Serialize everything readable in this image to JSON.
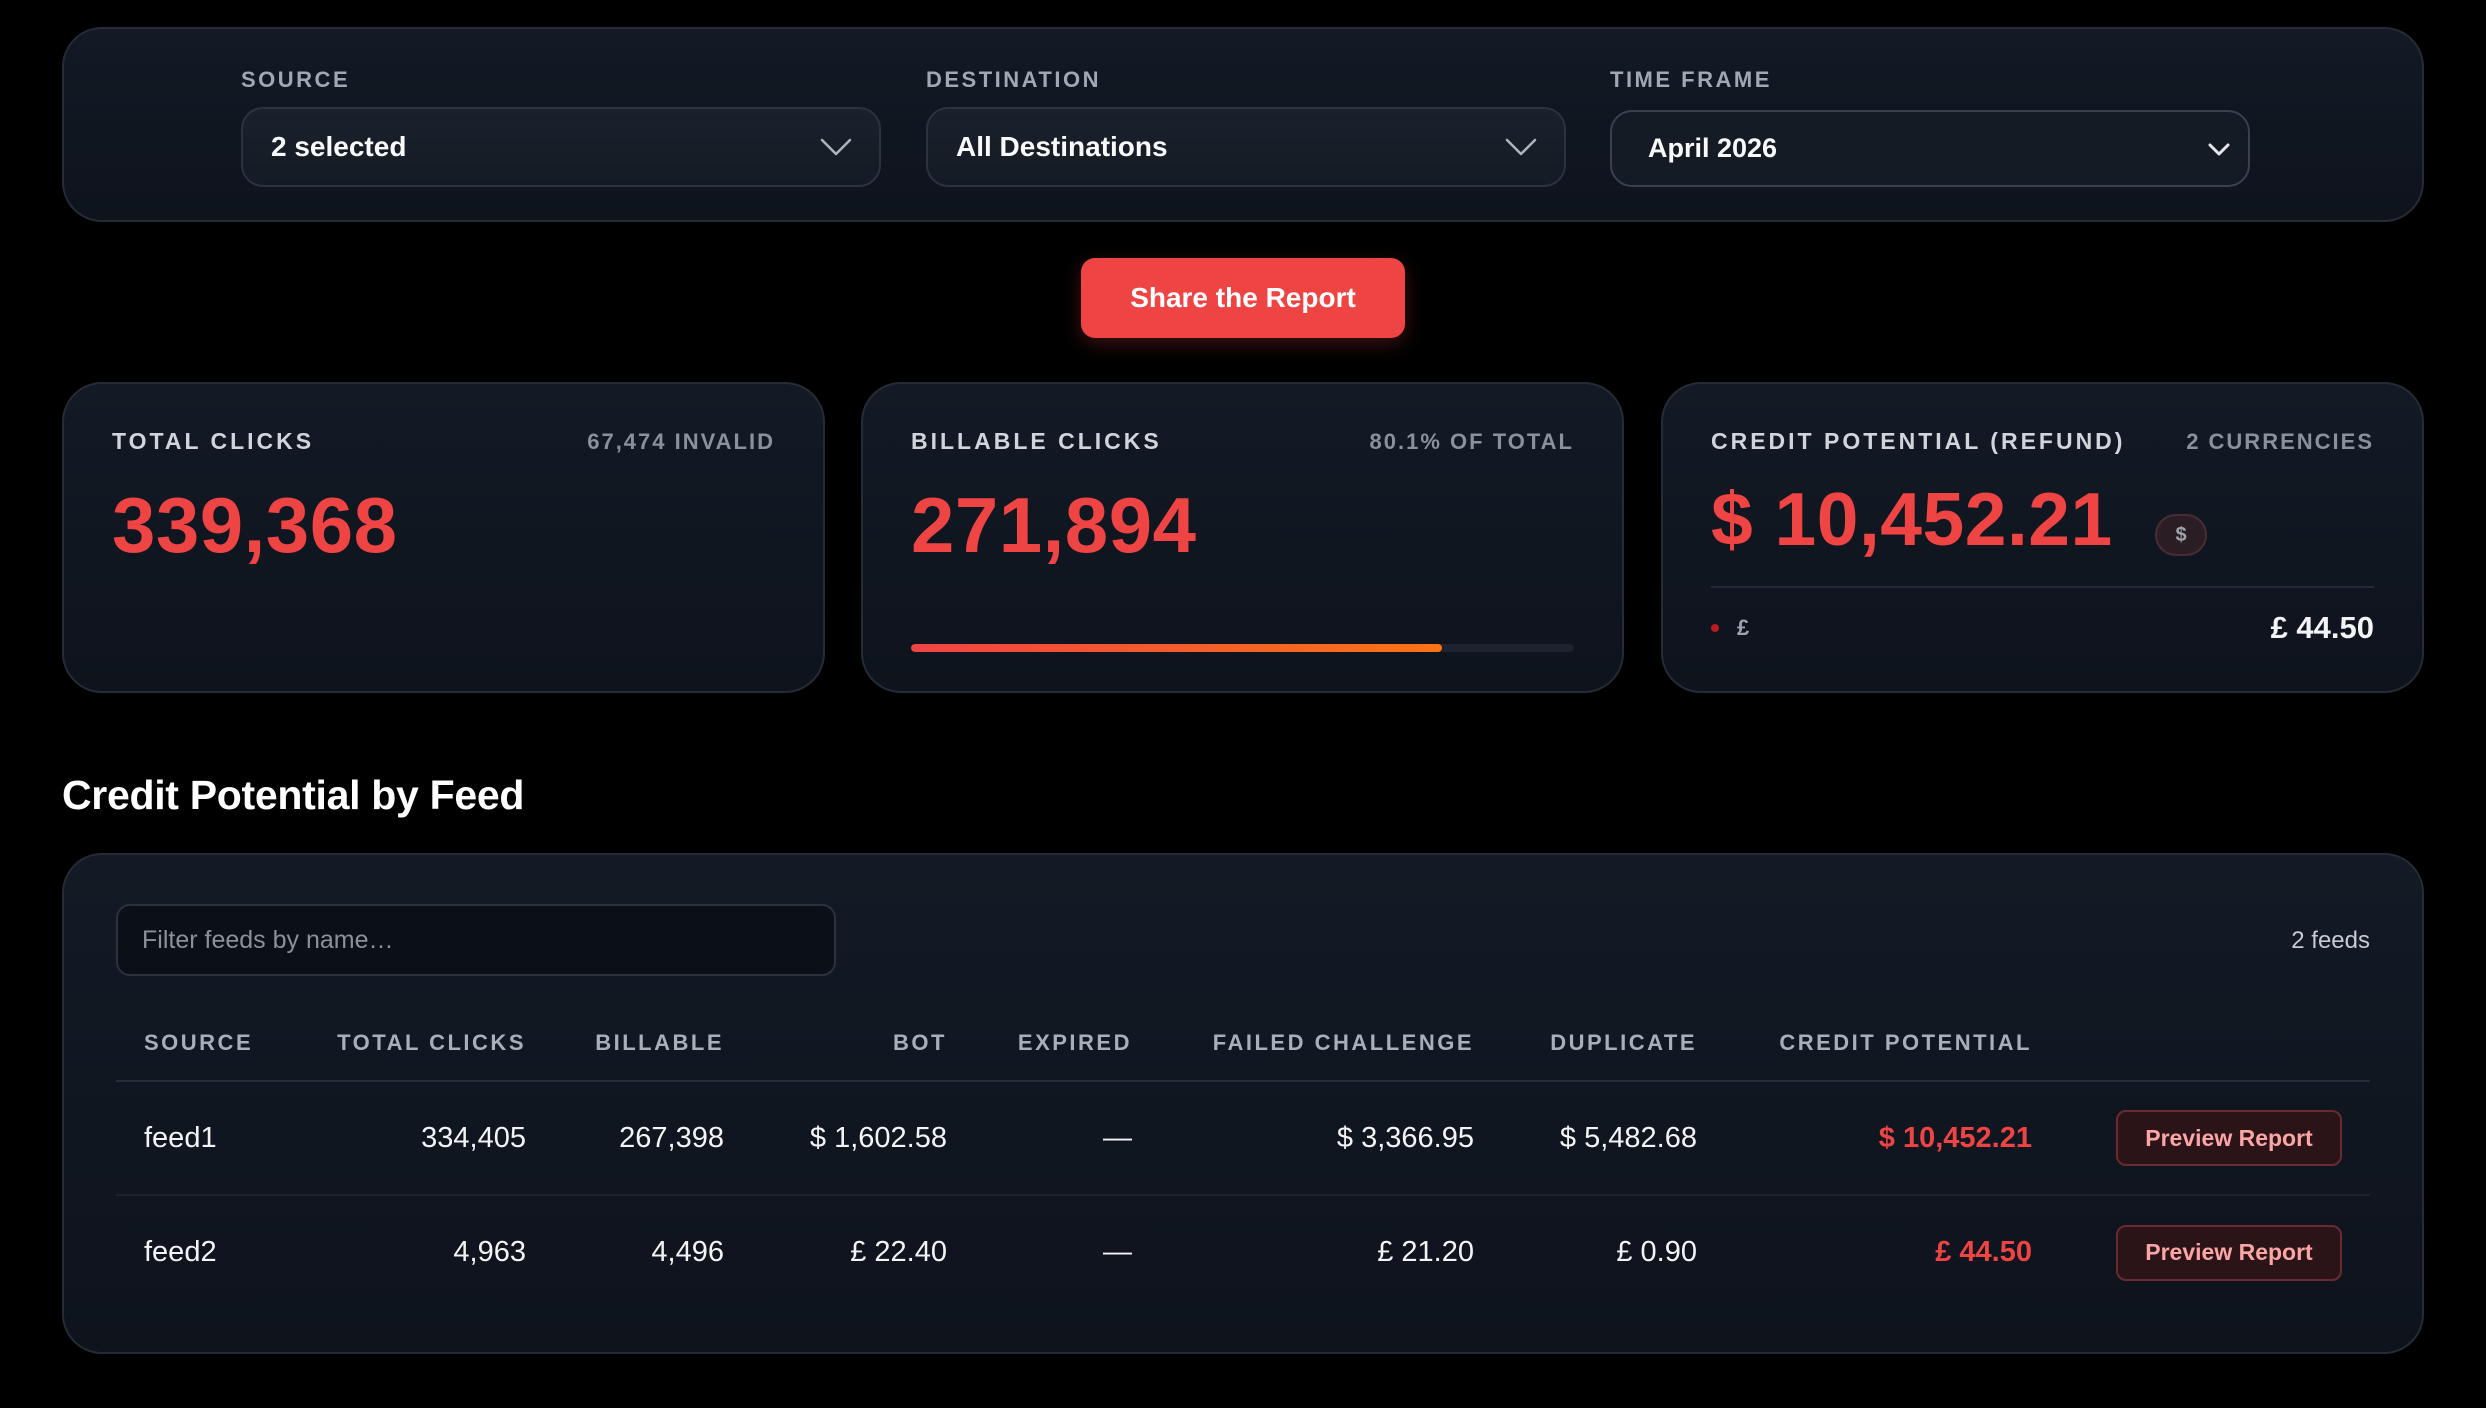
{
  "filters": {
    "source": {
      "label": "SOURCE",
      "value": "2 selected"
    },
    "destination": {
      "label": "DESTINATION",
      "value": "All Destinations"
    },
    "time_frame": {
      "label": "TIME FRAME",
      "value": "April 2026"
    }
  },
  "share_button": {
    "label": "Share the Report"
  },
  "stats": {
    "total_clicks": {
      "title": "TOTAL CLICKS",
      "sub": "67,474 INVALID",
      "value": "339,368"
    },
    "billable_clicks": {
      "title": "BILLABLE CLICKS",
      "sub": "80.1% OF TOTAL",
      "value": "271,894",
      "progress_fraction": 0.801
    },
    "credit_potential": {
      "title": "CREDIT POTENTIAL (REFUND)",
      "sub": "2 CURRENCIES",
      "value": "$ 10,452.21",
      "badge": "$",
      "secondary_currency": "£",
      "secondary_value": "£ 44.50"
    }
  },
  "section": {
    "title": "Credit Potential by Feed"
  },
  "table": {
    "filter_placeholder": "Filter feeds by name…",
    "count": "2 feeds",
    "columns": [
      "SOURCE",
      "TOTAL CLICKS",
      "BILLABLE",
      "BOT",
      "EXPIRED",
      "FAILED CHALLENGE",
      "DUPLICATE",
      "CREDIT POTENTIAL",
      ""
    ],
    "rows": [
      {
        "source": "feed1",
        "total_clicks": "334,405",
        "billable": "267,398",
        "bot": "$ 1,602.58",
        "expired": "—",
        "failed_challenge": "$ 3,366.95",
        "duplicate": "$ 5,482.68",
        "credit_potential": "$ 10,452.21",
        "action": "Preview Report"
      },
      {
        "source": "feed2",
        "total_clicks": "4,963",
        "billable": "4,496",
        "bot": "£ 22.40",
        "expired": "—",
        "failed_challenge": "£ 21.20",
        "duplicate": "£ 0.90",
        "credit_potential": "£ 44.50",
        "action": "Preview Report"
      }
    ]
  },
  "colors": {
    "accent": "#ef4444",
    "accent_gradient_end": "#f97316",
    "background": "#000000",
    "panel": "#131a25"
  },
  "icons": {
    "dropdown": "chevron-down-icon"
  }
}
